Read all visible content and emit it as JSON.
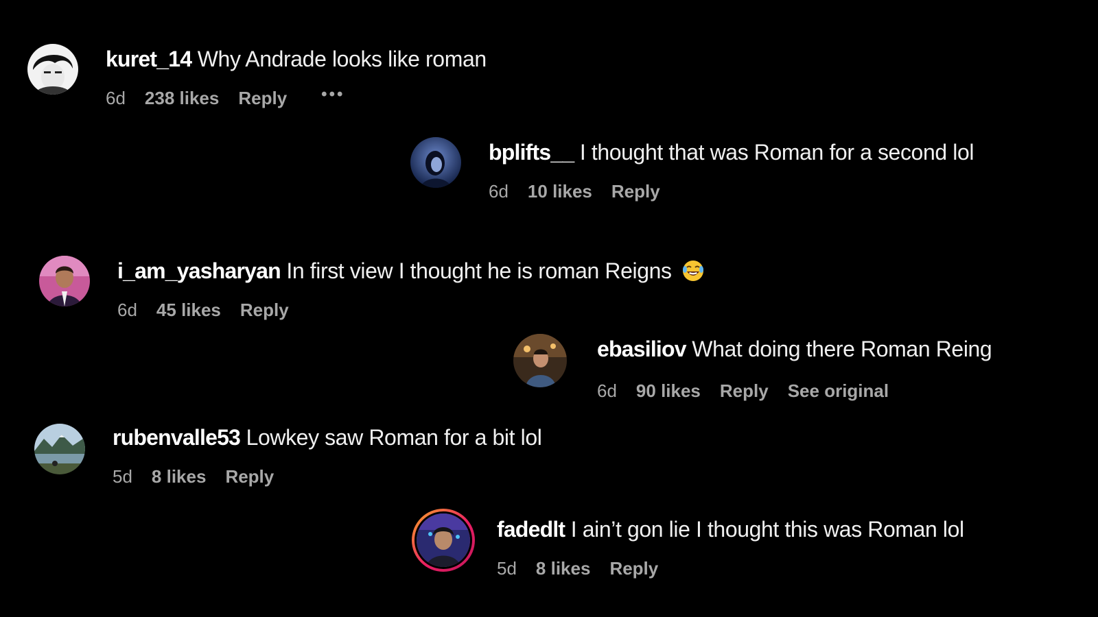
{
  "colors": {
    "background": "#000000",
    "username": "#ffffff",
    "text": "#f0f0f0",
    "meta": "#a8a8a8",
    "story_ring_start": "#f9a825",
    "story_ring_end": "#c2185b"
  },
  "comments": [
    {
      "username": "kuret_14",
      "text": "Why Andrade looks like roman",
      "time": "6d",
      "likes": "238 likes",
      "reply": "Reply",
      "more": "•••",
      "avatar": "user-avatar"
    },
    {
      "username": "bplifts__",
      "text": "I thought that was Roman for a second lol",
      "time": "6d",
      "likes": "10 likes",
      "reply": "Reply",
      "avatar": "user-avatar"
    },
    {
      "username": "i_am_yasharyan",
      "text": "In first view I thought he is roman Reigns",
      "emoji": "laughing-tears-emoji",
      "time": "6d",
      "likes": "45 likes",
      "reply": "Reply",
      "avatar": "user-avatar"
    },
    {
      "username": "ebasiliov",
      "text": "What doing there Roman Reing",
      "time": "6d",
      "likes": "90 likes",
      "reply": "Reply",
      "see_original": "See original",
      "avatar": "user-avatar"
    },
    {
      "username": "rubenvalle53",
      "text": "Lowkey saw Roman for a bit lol",
      "time": "5d",
      "likes": "8 likes",
      "reply": "Reply",
      "avatar": "user-avatar"
    },
    {
      "username": "fadedlt",
      "text": "I ain’t gon lie I thought this was Roman lol",
      "time": "5d",
      "likes": "8 likes",
      "reply": "Reply",
      "avatar": "user-avatar-story-ring"
    }
  ]
}
